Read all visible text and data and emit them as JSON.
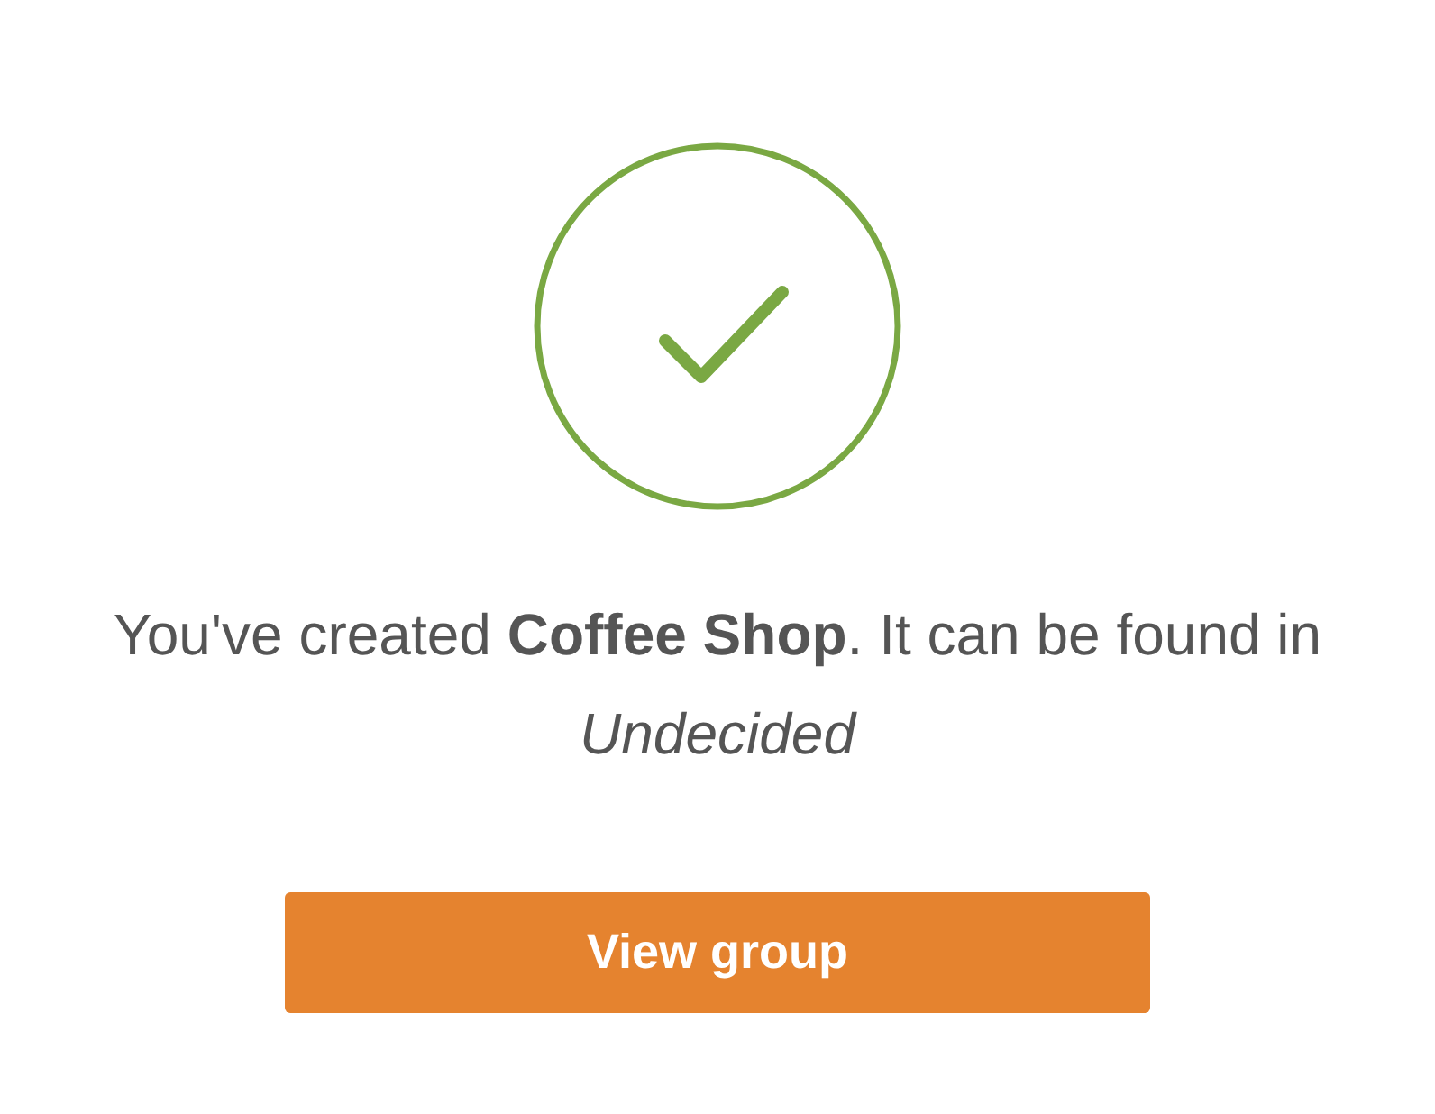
{
  "message": "You've created **Coffee Shop**. It can be found in *Undecided*",
  "button": {
    "label": "View group"
  }
}
